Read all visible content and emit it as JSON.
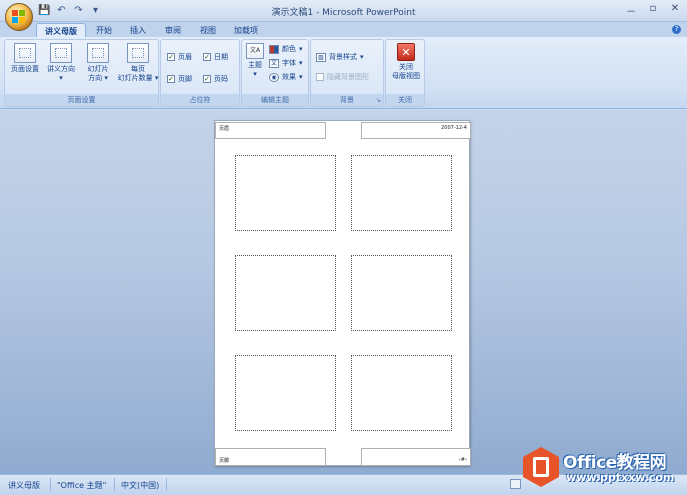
{
  "window": {
    "title": "演示文稿1 - Microsoft PowerPoint",
    "controls": [
      "－",
      "▫",
      "✕"
    ]
  },
  "qat": {
    "save": "💾",
    "undo": "↶",
    "redo": "↷",
    "customize": "▾"
  },
  "tabs": [
    {
      "label": "讲义母版",
      "active": true
    },
    {
      "label": "开始",
      "active": false
    },
    {
      "label": "插入",
      "active": false
    },
    {
      "label": "审阅",
      "active": false
    },
    {
      "label": "视图",
      "active": false
    },
    {
      "label": "加载项",
      "active": false
    }
  ],
  "ribbon": {
    "page_setup": {
      "label": "页面设置",
      "page_setup_btn": "页面设置",
      "orientation_btn": "讲义方向",
      "slide_orientation_btn_1": "幻灯片",
      "slide_orientation_btn_2": "方向",
      "slides_per_page_1": "每页",
      "slides_per_page_2": "幻灯片数量"
    },
    "placeholders": {
      "label": "占位符",
      "header": "页眉",
      "date": "日期",
      "footer": "页脚",
      "page_number": "页码"
    },
    "edit_theme": {
      "label": "编辑主题",
      "themes": "主题",
      "colors": "颜色",
      "fonts": "字体",
      "effects": "效果",
      "theme_icon_text": "文A"
    },
    "background": {
      "label": "背景",
      "styles": "背景样式",
      "hide_graphics": "隐藏背景图形"
    },
    "close": {
      "label": "关闭",
      "close_btn_1": "关闭",
      "close_btn_2": "母版视图"
    }
  },
  "handout": {
    "header_text": "页眉",
    "date_text": "2007-12-4",
    "footer_text": "页脚",
    "page_number_text": "‹#›"
  },
  "status": {
    "view": "讲义母版",
    "theme": "\"Office 主题\"",
    "language": "中文(中国)"
  },
  "watermark": {
    "title": "Office教程网",
    "url": "www.pptxxw.com"
  },
  "colors": {
    "accent": "#15428b",
    "ribbon_bg": "#d2e1f4",
    "workspace_bg": "#b7c9e3"
  }
}
